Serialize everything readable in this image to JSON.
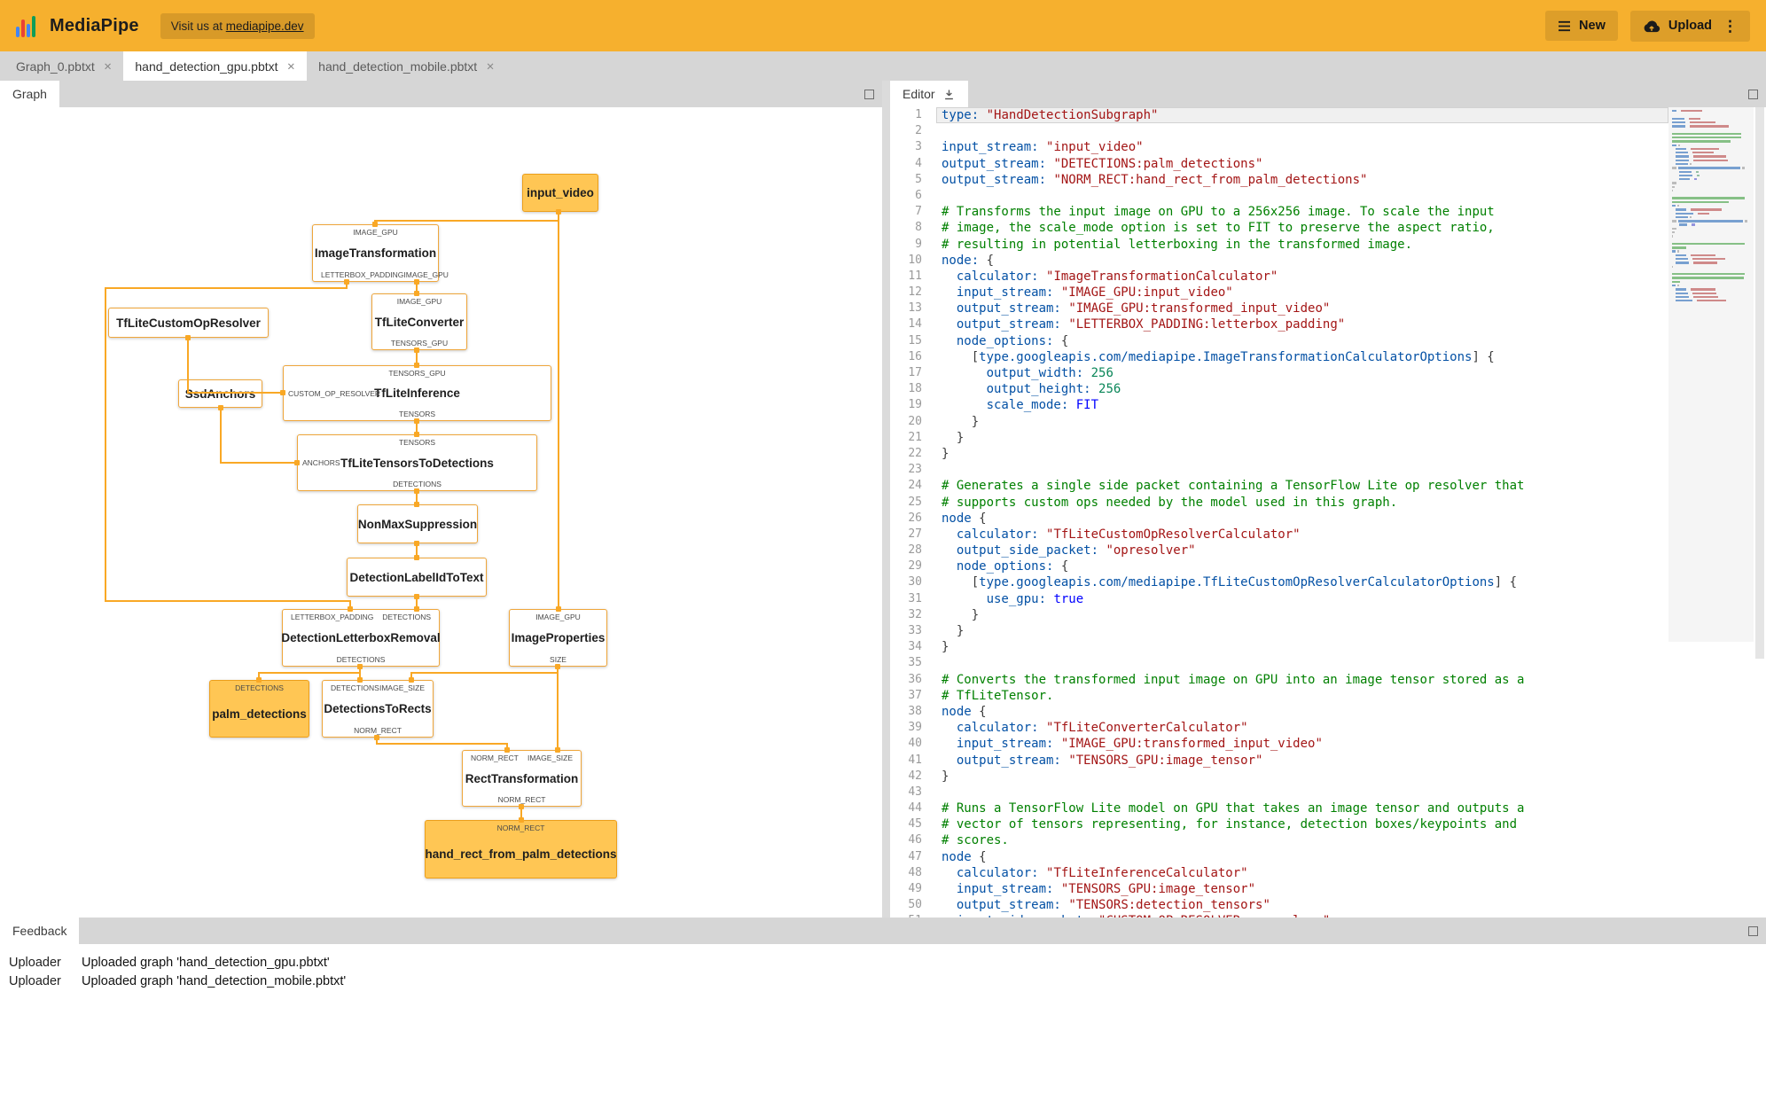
{
  "header": {
    "app_title": "MediaPipe",
    "visit_prefix": "Visit us at ",
    "visit_link": "mediapipe.dev",
    "new_label": "New",
    "upload_label": "Upload"
  },
  "file_tabs": [
    {
      "label": "Graph_0.pbtxt",
      "active": false
    },
    {
      "label": "hand_detection_gpu.pbtxt",
      "active": true
    },
    {
      "label": "hand_detection_mobile.pbtxt",
      "active": false
    }
  ],
  "graph_panel": {
    "tab_label": "Graph"
  },
  "editor_panel": {
    "tab_label": "Editor"
  },
  "feedback_panel": {
    "tab_label": "Feedback",
    "entries": [
      {
        "source": "Uploader",
        "message": "Uploaded graph 'hand_detection_gpu.pbtxt'"
      },
      {
        "source": "Uploader",
        "message": "Uploaded graph 'hand_detection_mobile.pbtxt'"
      }
    ]
  },
  "graph": {
    "nodes": [
      {
        "label": "input_video",
        "kind": "stream"
      },
      {
        "label": "ImageTransformation",
        "kind": "calculator",
        "top_ports": [
          "IMAGE_GPU"
        ],
        "bottom_ports": [
          "LETTERBOX_PADDING",
          "IMAGE_GPU"
        ]
      },
      {
        "label": "TfLiteConverter",
        "kind": "calculator",
        "top_ports": [
          "IMAGE_GPU"
        ],
        "bottom_ports": [
          "TENSORS_GPU"
        ]
      },
      {
        "label": "TfLiteCustomOpResolver",
        "kind": "calculator"
      },
      {
        "label": "SsdAnchors",
        "kind": "calculator"
      },
      {
        "label": "TfLiteInference",
        "kind": "calculator",
        "top_ports": [
          "TENSORS_GPU"
        ],
        "left_ports": [
          "CUSTOM_OP_RESOLVER"
        ],
        "bottom_ports": [
          "TENSORS"
        ]
      },
      {
        "label": "TfLiteTensorsToDetections",
        "kind": "calculator",
        "top_ports": [
          "TENSORS"
        ],
        "left_ports": [
          "ANCHORS"
        ],
        "bottom_ports": [
          "DETECTIONS"
        ]
      },
      {
        "label": "NonMaxSuppression",
        "kind": "calculator"
      },
      {
        "label": "DetectionLabelIdToText",
        "kind": "calculator"
      },
      {
        "label": "DetectionLetterboxRemoval",
        "kind": "calculator",
        "top_ports": [
          "LETTERBOX_PADDING",
          "DETECTIONS"
        ],
        "bottom_ports": [
          "DETECTIONS"
        ]
      },
      {
        "label": "ImageProperties",
        "kind": "calculator",
        "top_ports": [
          "IMAGE_GPU"
        ],
        "bottom_ports": [
          "SIZE"
        ]
      },
      {
        "label": "palm_detections",
        "kind": "stream",
        "top_ports": [
          "DETECTIONS"
        ]
      },
      {
        "label": "DetectionsToRects",
        "kind": "calculator",
        "top_ports": [
          "DETECTIONS",
          "IMAGE_SIZE"
        ],
        "bottom_ports": [
          "NORM_RECT"
        ]
      },
      {
        "label": "RectTransformation",
        "kind": "calculator",
        "top_ports": [
          "NORM_RECT",
          "IMAGE_SIZE"
        ],
        "bottom_ports": [
          "NORM_RECT"
        ]
      },
      {
        "label": "hand_rect_from_palm_detections",
        "kind": "stream",
        "top_ports": [
          "NORM_RECT"
        ]
      }
    ]
  },
  "editor": {
    "lines": [
      [
        [
          "k",
          "type:"
        ],
        [
          "p",
          " "
        ],
        [
          "s",
          "\"HandDetectionSubgraph\""
        ]
      ],
      [],
      [
        [
          "k",
          "input_stream:"
        ],
        [
          "p",
          " "
        ],
        [
          "s",
          "\"input_video\""
        ]
      ],
      [
        [
          "k",
          "output_stream:"
        ],
        [
          "p",
          " "
        ],
        [
          "s",
          "\"DETECTIONS:palm_detections\""
        ]
      ],
      [
        [
          "k",
          "output_stream:"
        ],
        [
          "p",
          " "
        ],
        [
          "s",
          "\"NORM_RECT:hand_rect_from_palm_detections\""
        ]
      ],
      [],
      [
        [
          "c",
          "# Transforms the input image on GPU to a 256x256 image. To scale the input"
        ]
      ],
      [
        [
          "c",
          "# image, the scale_mode option is set to FIT to preserve the aspect ratio,"
        ]
      ],
      [
        [
          "c",
          "# resulting in potential letterboxing in the transformed image."
        ]
      ],
      [
        [
          "k",
          "node:"
        ],
        [
          "p",
          " {"
        ]
      ],
      [
        [
          "p",
          "  "
        ],
        [
          "k",
          "calculator:"
        ],
        [
          "p",
          " "
        ],
        [
          "s",
          "\"ImageTransformationCalculator\""
        ]
      ],
      [
        [
          "p",
          "  "
        ],
        [
          "k",
          "input_stream:"
        ],
        [
          "p",
          " "
        ],
        [
          "s",
          "\"IMAGE_GPU:input_video\""
        ]
      ],
      [
        [
          "p",
          "  "
        ],
        [
          "k",
          "output_stream:"
        ],
        [
          "p",
          " "
        ],
        [
          "s",
          "\"IMAGE_GPU:transformed_input_video\""
        ]
      ],
      [
        [
          "p",
          "  "
        ],
        [
          "k",
          "output_stream:"
        ],
        [
          "p",
          " "
        ],
        [
          "s",
          "\"LETTERBOX_PADDING:letterbox_padding\""
        ]
      ],
      [
        [
          "p",
          "  "
        ],
        [
          "k",
          "node_options:"
        ],
        [
          "p",
          " {"
        ]
      ],
      [
        [
          "p",
          "    ["
        ],
        [
          "t",
          "type.googleapis.com/mediapipe.ImageTransformationCalculatorOptions"
        ],
        [
          "p",
          "] {"
        ]
      ],
      [
        [
          "p",
          "      "
        ],
        [
          "k",
          "output_width:"
        ],
        [
          "p",
          " "
        ],
        [
          "n",
          "256"
        ]
      ],
      [
        [
          "p",
          "      "
        ],
        [
          "k",
          "output_height:"
        ],
        [
          "p",
          " "
        ],
        [
          "n",
          "256"
        ]
      ],
      [
        [
          "p",
          "      "
        ],
        [
          "k",
          "scale_mode:"
        ],
        [
          "p",
          " "
        ],
        [
          "b",
          "FIT"
        ]
      ],
      [
        [
          "p",
          "    }"
        ]
      ],
      [
        [
          "p",
          "  }"
        ]
      ],
      [
        [
          "p",
          "}"
        ]
      ],
      [],
      [
        [
          "c",
          "# Generates a single side packet containing a TensorFlow Lite op resolver that"
        ]
      ],
      [
        [
          "c",
          "# supports custom ops needed by the model used in this graph."
        ]
      ],
      [
        [
          "k",
          "node"
        ],
        [
          "p",
          " {"
        ]
      ],
      [
        [
          "p",
          "  "
        ],
        [
          "k",
          "calculator:"
        ],
        [
          "p",
          " "
        ],
        [
          "s",
          "\"TfLiteCustomOpResolverCalculator\""
        ]
      ],
      [
        [
          "p",
          "  "
        ],
        [
          "k",
          "output_side_packet:"
        ],
        [
          "p",
          " "
        ],
        [
          "s",
          "\"opresolver\""
        ]
      ],
      [
        [
          "p",
          "  "
        ],
        [
          "k",
          "node_options:"
        ],
        [
          "p",
          " {"
        ]
      ],
      [
        [
          "p",
          "    ["
        ],
        [
          "t",
          "type.googleapis.com/mediapipe.TfLiteCustomOpResolverCalculatorOptions"
        ],
        [
          "p",
          "] {"
        ]
      ],
      [
        [
          "p",
          "      "
        ],
        [
          "k",
          "use_gpu:"
        ],
        [
          "p",
          " "
        ],
        [
          "b",
          "true"
        ]
      ],
      [
        [
          "p",
          "    }"
        ]
      ],
      [
        [
          "p",
          "  }"
        ]
      ],
      [
        [
          "p",
          "}"
        ]
      ],
      [],
      [
        [
          "c",
          "# Converts the transformed input image on GPU into an image tensor stored as a"
        ]
      ],
      [
        [
          "c",
          "# TfLiteTensor."
        ]
      ],
      [
        [
          "k",
          "node"
        ],
        [
          "p",
          " {"
        ]
      ],
      [
        [
          "p",
          "  "
        ],
        [
          "k",
          "calculator:"
        ],
        [
          "p",
          " "
        ],
        [
          "s",
          "\"TfLiteConverterCalculator\""
        ]
      ],
      [
        [
          "p",
          "  "
        ],
        [
          "k",
          "input_stream:"
        ],
        [
          "p",
          " "
        ],
        [
          "s",
          "\"IMAGE_GPU:transformed_input_video\""
        ]
      ],
      [
        [
          "p",
          "  "
        ],
        [
          "k",
          "output_stream:"
        ],
        [
          "p",
          " "
        ],
        [
          "s",
          "\"TENSORS_GPU:image_tensor\""
        ]
      ],
      [
        [
          "p",
          "}"
        ]
      ],
      [],
      [
        [
          "c",
          "# Runs a TensorFlow Lite model on GPU that takes an image tensor and outputs a"
        ]
      ],
      [
        [
          "c",
          "# vector of tensors representing, for instance, detection boxes/keypoints and"
        ]
      ],
      [
        [
          "c",
          "# scores."
        ]
      ],
      [
        [
          "k",
          "node"
        ],
        [
          "p",
          " {"
        ]
      ],
      [
        [
          "p",
          "  "
        ],
        [
          "k",
          "calculator:"
        ],
        [
          "p",
          " "
        ],
        [
          "s",
          "\"TfLiteInferenceCalculator\""
        ]
      ],
      [
        [
          "p",
          "  "
        ],
        [
          "k",
          "input_stream:"
        ],
        [
          "p",
          " "
        ],
        [
          "s",
          "\"TENSORS_GPU:image_tensor\""
        ]
      ],
      [
        [
          "p",
          "  "
        ],
        [
          "k",
          "output_stream:"
        ],
        [
          "p",
          " "
        ],
        [
          "s",
          "\"TENSORS:detection_tensors\""
        ]
      ],
      [
        [
          "p",
          "  "
        ],
        [
          "k",
          "input_side_packet:"
        ],
        [
          "p",
          " "
        ],
        [
          "s",
          "\"CUSTOM_OP_RESOLVER:opresolver\""
        ]
      ]
    ]
  },
  "appearance": {
    "header_color": "#F6B02E",
    "stream_node_fill": "#FFC654",
    "edge_color": "#F9A825",
    "comment_color": "#008000",
    "key_color": "#0451A5",
    "string_color": "#A31515"
  }
}
